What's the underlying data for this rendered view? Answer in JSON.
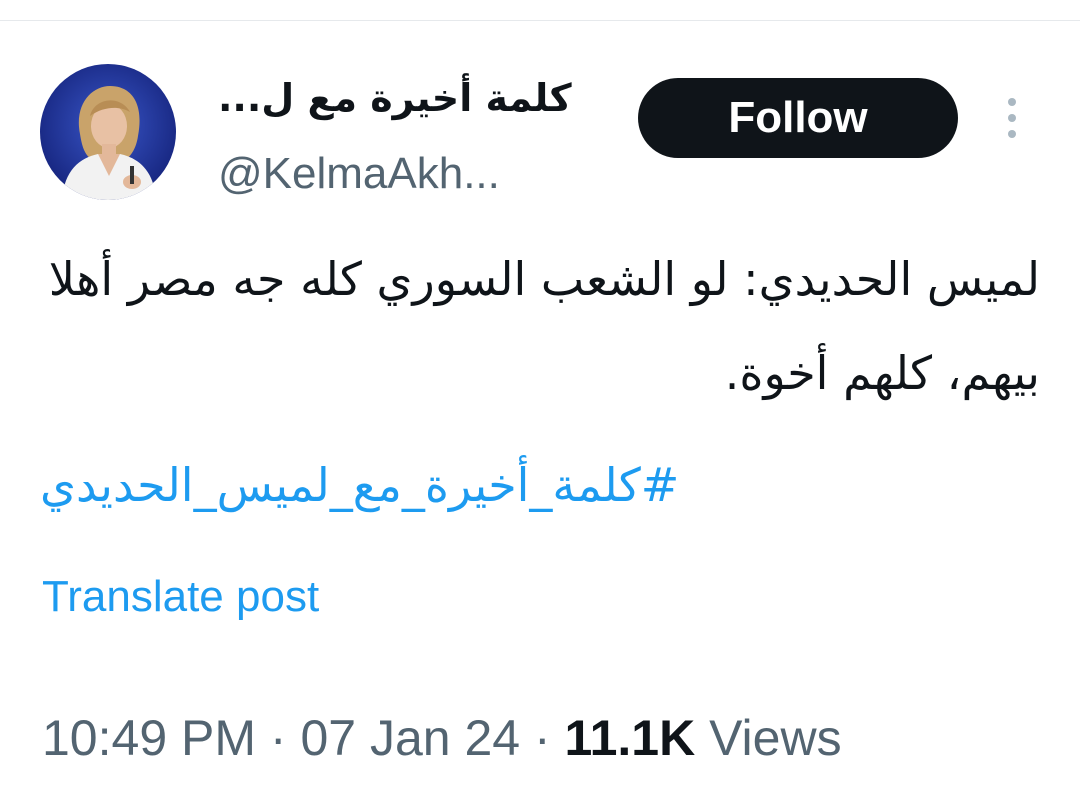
{
  "author": {
    "display_name": "كلمة أخيرة مع ل...",
    "handle": "@KelmaAkh...",
    "avatar": "avatar-photo"
  },
  "actions": {
    "follow_label": "Follow",
    "more_icon": "more-vertical-icon"
  },
  "post": {
    "text": "لميس الحديدي: لو الشعب السوري كله جه مصر أهلا بيهم، كلهم أخوة.",
    "hashtag": "#كلمة_أخيرة_مع_لميس_الحديدي",
    "translate_label": "Translate post"
  },
  "meta": {
    "time": "10:49 PM",
    "separator": " · ",
    "date": "07 Jan 24",
    "views_count": "11.1K",
    "views_label": "Views"
  },
  "colors": {
    "link": "#1d9bf0",
    "text": "#0f1419",
    "secondary": "#536471",
    "button_bg": "#0f1419"
  }
}
